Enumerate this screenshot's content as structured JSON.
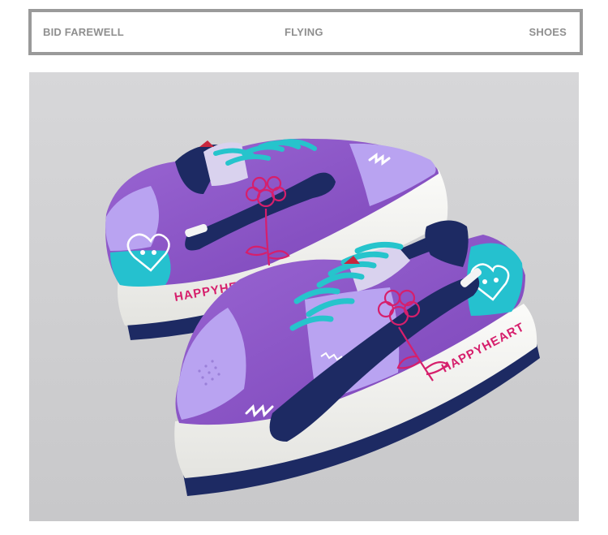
{
  "header": {
    "left_text": "BID FAREWELL",
    "center_text": "FLYING",
    "right_text": "SHOES"
  },
  "product_photo": {
    "brand_text_back": "HAPPYHEART",
    "brand_text_front": "HAPPYHEART",
    "colors": {
      "background": "#cfcfd1",
      "purple": "#8c55c6",
      "lavender": "#b9a3f1",
      "navy": "#1d2a63",
      "teal": "#25c1cf",
      "pink": "#d61f6c",
      "sole": "#f2f2f0"
    }
  }
}
